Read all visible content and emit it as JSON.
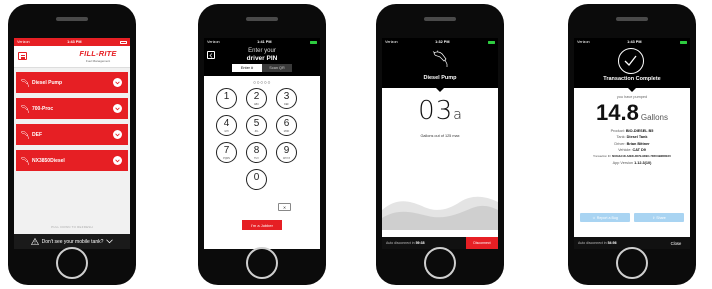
{
  "colors": {
    "brand_red": "#e61f24",
    "dark": "#000000",
    "accent_blue": "#a9d4f2"
  },
  "phone1": {
    "status": {
      "carrier": "Verizon",
      "time": "1:43 PM"
    },
    "logo": {
      "brand": "FILL-RITE",
      "tagline": "Fuel Management"
    },
    "menu_icon": "hamburger-icon",
    "tanks": [
      {
        "label": "Diesel Pump",
        "icon": "fuel-nozzle-icon"
      },
      {
        "label": "700-Proc",
        "icon": "fuel-nozzle-icon"
      },
      {
        "label": "DEF",
        "icon": "fuel-nozzle-icon"
      },
      {
        "label": "NX3850Diesel",
        "icon": "fuel-nozzle-icon"
      }
    ],
    "hint": "PULL DOWN TO REFRESH",
    "footer": "Don't see your mobile tank?"
  },
  "phone2": {
    "status": {
      "carrier": "Verizon",
      "time": "1:41 PM"
    },
    "title_line1": "Enter your",
    "title_line2": "driver PIN",
    "tabs": [
      "Enter #",
      "Scan QR"
    ],
    "pin_dots": "○○○○○",
    "keys": [
      {
        "num": "1",
        "letters": ""
      },
      {
        "num": "2",
        "letters": "ABC"
      },
      {
        "num": "3",
        "letters": "DEF"
      },
      {
        "num": "4",
        "letters": "GHI"
      },
      {
        "num": "5",
        "letters": "JKL"
      },
      {
        "num": "6",
        "letters": "MNO"
      },
      {
        "num": "7",
        "letters": "PQRS"
      },
      {
        "num": "8",
        "letters": "TUV"
      },
      {
        "num": "9",
        "letters": "WXYZ"
      },
      {
        "num": "0",
        "letters": ""
      }
    ],
    "delete_glyph": "✕",
    "jobber_button": "I'm a Jobber"
  },
  "phone3": {
    "status": {
      "carrier": "Verizon",
      "time": "1:32 PM"
    },
    "pump_name": "Diesel Pump",
    "reading_whole": "03",
    "reading_fraction": "a",
    "gallons_out_of": "Gallons out of 125 max",
    "auto_disconnect_label": "Auto disconnect in",
    "auto_disconnect_time": "59:38",
    "disconnect_button": "Disconnect"
  },
  "phone4": {
    "status": {
      "carrier": "Verizon",
      "time": "1:43 PM"
    },
    "title": "Transaction Complete",
    "pumped_label": "you have pumped",
    "amount": "14.8",
    "unit": "Gallons",
    "details": [
      {
        "label": "Product:",
        "value": "BIO-DIESEL B5"
      },
      {
        "label": "Tank:",
        "value": "Diesel Tank"
      },
      {
        "label": "Driver:",
        "value": "Brian Bittner"
      },
      {
        "label": "Vehicle:",
        "value": "CAT D9"
      },
      {
        "label": "Transaction ID:",
        "value": "6C8A4A1D-A3ED-4D7E-9DEC-7DFC9B2DDE15"
      },
      {
        "label": "App Version",
        "value": "1.12.3(10)"
      }
    ],
    "report_button": "Report a Bug",
    "share_button": "Share",
    "auto_disconnect_label": "Auto disconnect in",
    "auto_disconnect_time": "54:56",
    "close_button": "Close"
  }
}
